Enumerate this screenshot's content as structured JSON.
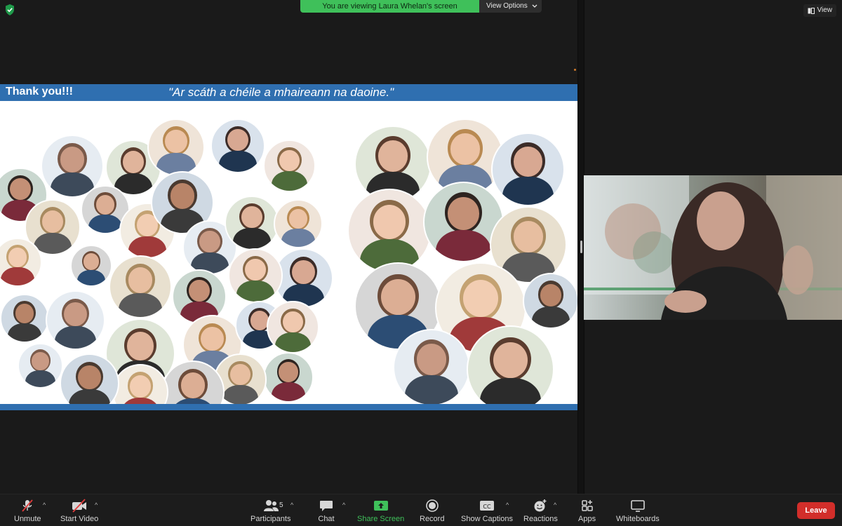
{
  "banner": {
    "viewing_text": "You are viewing Laura Whelan's screen",
    "options_label": "View Options"
  },
  "view_button": {
    "label": "View"
  },
  "slide": {
    "title": "Thank you!!!",
    "quote": "\"Ar scáth a chéile a mhaireann na daoine.\""
  },
  "toolbar": {
    "unmute": "Unmute",
    "start_video": "Start Video",
    "participants": "Participants",
    "participants_count": "5",
    "chat": "Chat",
    "share_screen": "Share Screen",
    "record": "Record",
    "show_captions": "Show Captions",
    "reactions": "Reactions",
    "apps": "Apps",
    "whiteboards": "Whiteboards",
    "leave": "Leave"
  },
  "icons": {
    "shield": "shield-check-icon",
    "mic": "mic-muted-icon",
    "video": "video-off-icon",
    "participants": "people-icon",
    "chat": "chat-bubble-icon",
    "share": "share-arrow-icon",
    "record": "record-icon",
    "captions": "cc-icon",
    "reactions": "emoji-plus-icon",
    "apps": "apps-icon",
    "whiteboards": "whiteboard-icon"
  },
  "colors": {
    "banner_green": "#3fc05a",
    "slide_blue": "#2f6fb0",
    "leave_red": "#d22e2a",
    "share_green": "#3fc05a"
  }
}
